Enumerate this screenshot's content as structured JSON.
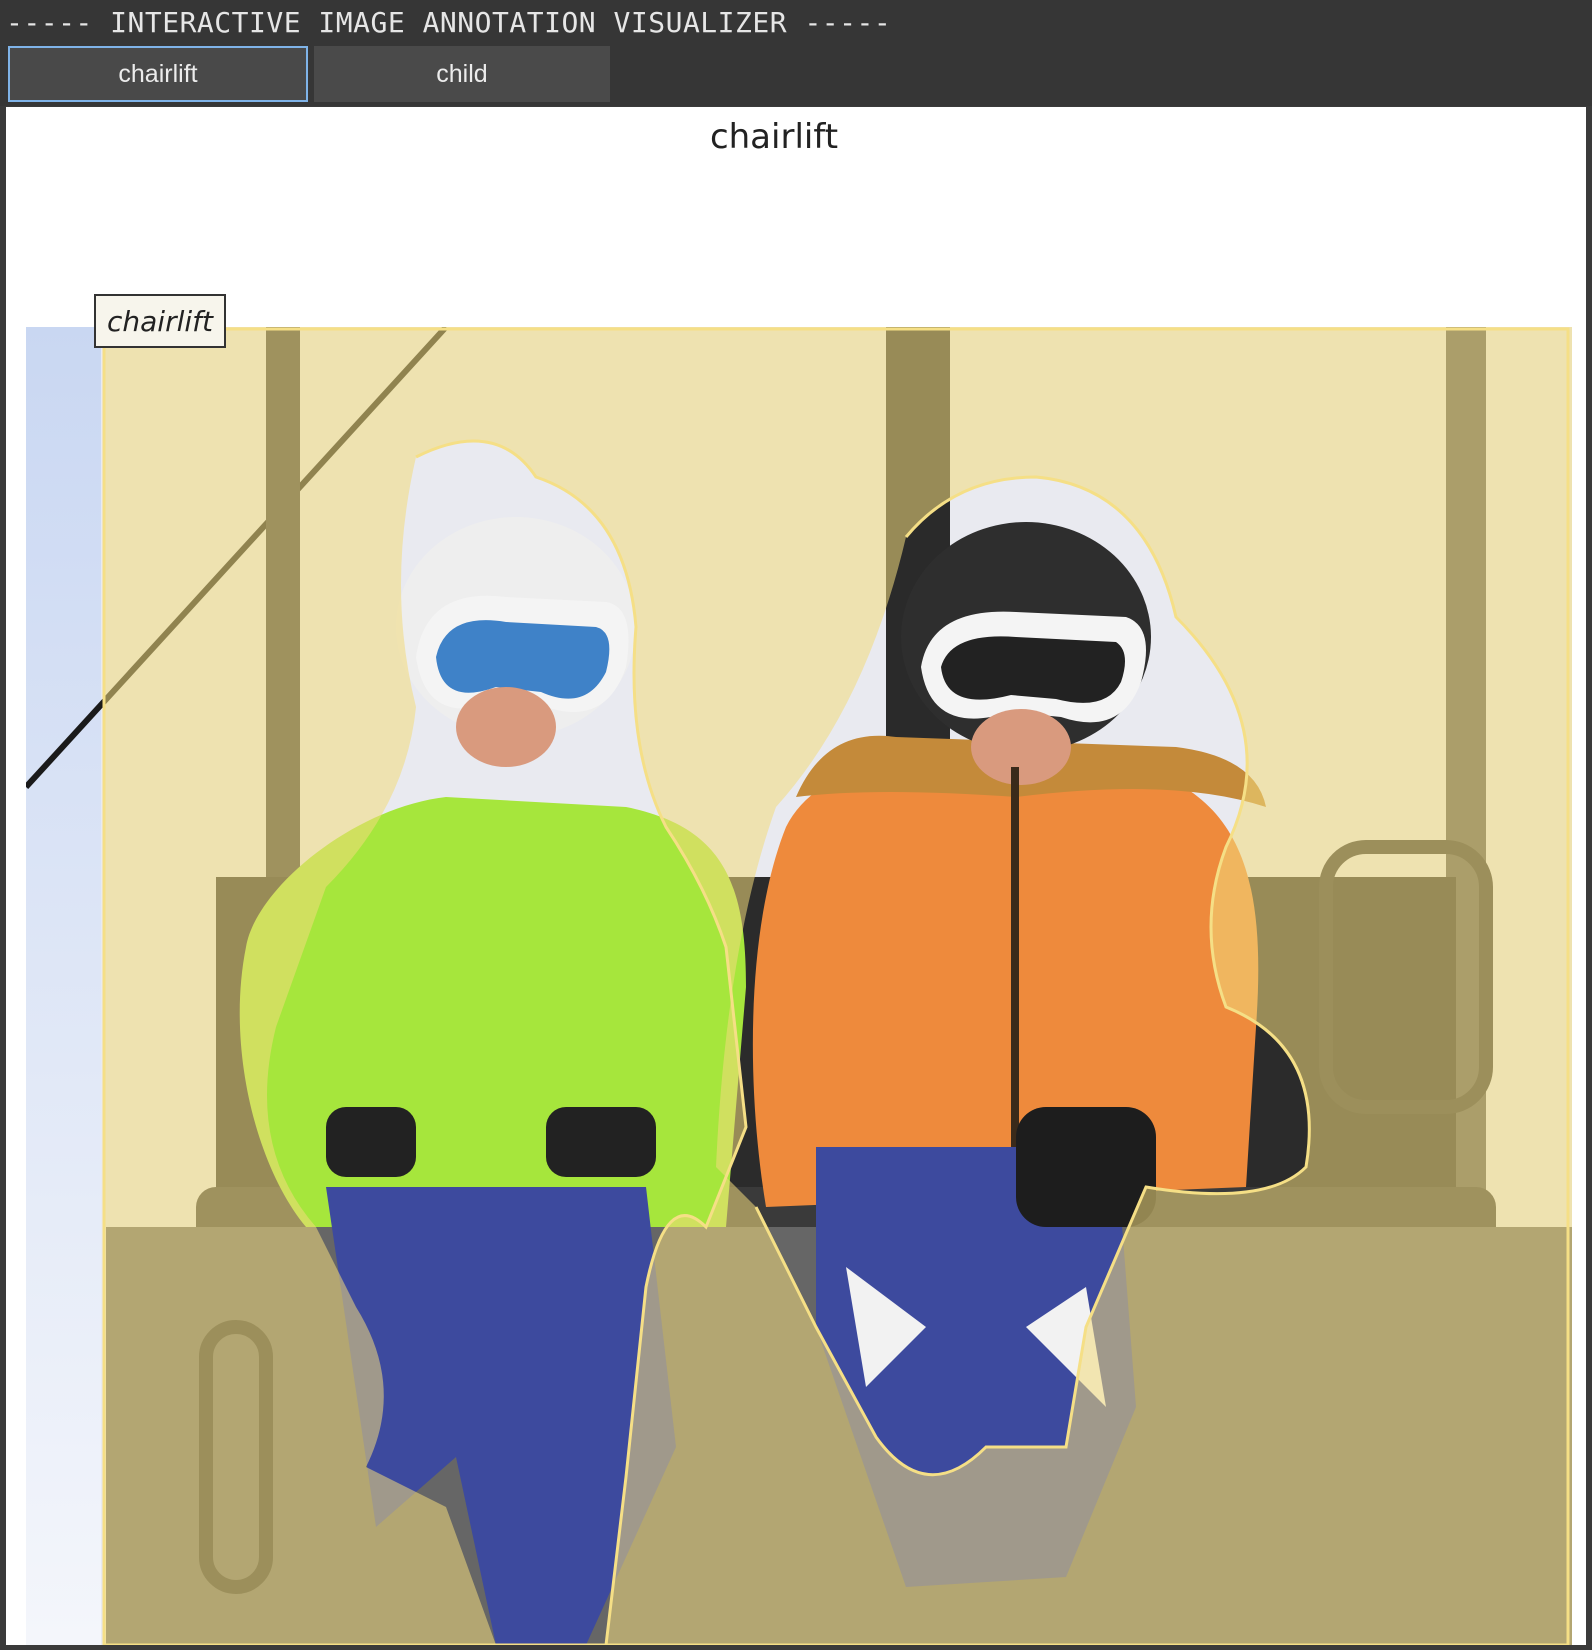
{
  "app": {
    "title": "----- INTERACTIVE IMAGE ANNOTATION VISUALIZER -----"
  },
  "tabs": [
    {
      "label": "chairlift",
      "active": true
    },
    {
      "label": "child",
      "active": false
    }
  ],
  "figure": {
    "title": "chairlift",
    "annotation_label": "chairlift",
    "mask_color": "#f3da7c",
    "mask_outline_color": "#f5df86"
  },
  "photo": {
    "scene": "two-children-on-chairlift",
    "colors": {
      "left_jacket": "#a6e63c",
      "right_jacket": "#ee8a3c",
      "pants": "#3d4a9e",
      "sky": "#dfe7f4",
      "seat": "#2b2b2b"
    }
  }
}
